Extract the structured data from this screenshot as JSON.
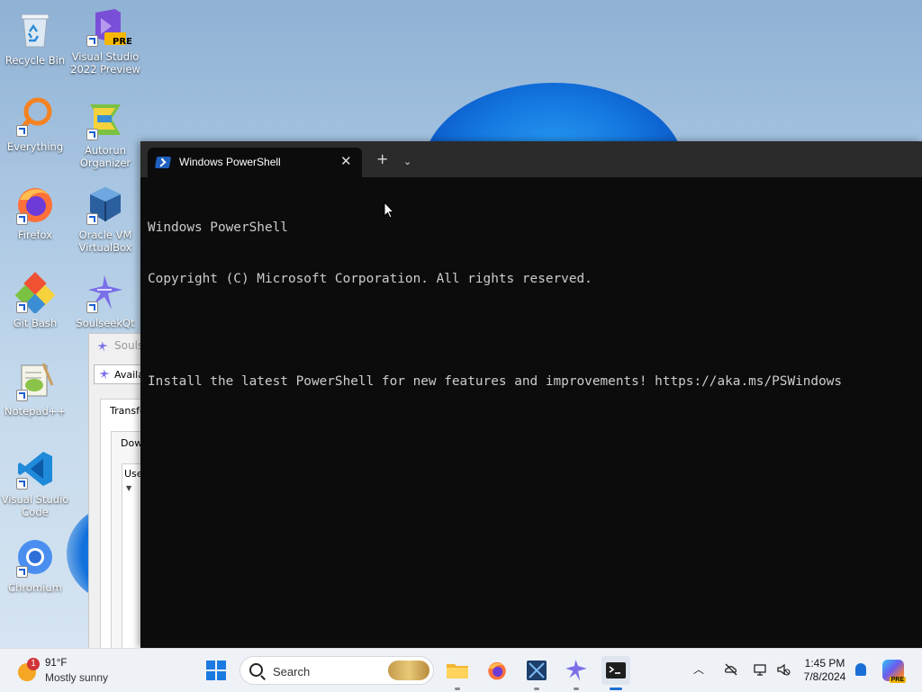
{
  "desktop": {
    "icons": [
      {
        "label_line1": "Recycle Bin",
        "label_line2": "",
        "icon": "recycle-bin-icon"
      },
      {
        "label_line1": "Visual Studio",
        "label_line2": "2022 Preview",
        "icon": "visual-studio-preview-icon",
        "badge": "PRE"
      },
      {
        "label_line1": "Everything",
        "label_line2": "",
        "icon": "everything-search-icon"
      },
      {
        "label_line1": "Autorun",
        "label_line2": "Organizer",
        "icon": "autorun-organizer-icon"
      },
      {
        "label_line1": "Firefox",
        "label_line2": "",
        "icon": "firefox-icon"
      },
      {
        "label_line1": "Oracle VM",
        "label_line2": "VirtualBox",
        "icon": "virtualbox-icon"
      },
      {
        "label_line1": "Git Bash",
        "label_line2": "",
        "icon": "git-bash-icon"
      },
      {
        "label_line1": "SoulseekQt",
        "label_line2": "",
        "icon": "soulseek-icon"
      },
      {
        "label_line1": "Notepad++",
        "label_line2": "",
        "icon": "notepad-plus-plus-icon"
      },
      {
        "label_line1": "Visual Studio",
        "label_line2": "Code",
        "icon": "vscode-icon"
      },
      {
        "label_line1": "Chromium",
        "label_line2": "",
        "icon": "chromium-icon"
      }
    ]
  },
  "background_window": {
    "title": "Souls",
    "button_label": "Availa",
    "tab1": "Transfe",
    "tab2": "Dow",
    "column": "User"
  },
  "terminal": {
    "tab_title": "Windows PowerShell",
    "close_glyph": "✕",
    "new_tab_glyph": "+",
    "dropdown_glyph": "⌄",
    "lines": [
      "Windows PowerShell",
      "Copyright (C) Microsoft Corporation. All rights reserved.",
      "",
      "Install the latest PowerShell for new features and improvements! https://aka.ms/PSWindows"
    ]
  },
  "taskbar": {
    "weather": {
      "temp": "91°F",
      "condition": "Mostly sunny",
      "alert_count": "1"
    },
    "search": {
      "placeholder": "Search"
    },
    "clock": {
      "time": "1:45 PM",
      "date": "7/8/2024"
    },
    "copilot_badge": "PRE"
  },
  "colors": {
    "terminal_bg": "#0c0c0c",
    "tabbar_bg": "#2b2b2b",
    "console_text": "#cccccc",
    "accent": "#1a6fd6"
  }
}
